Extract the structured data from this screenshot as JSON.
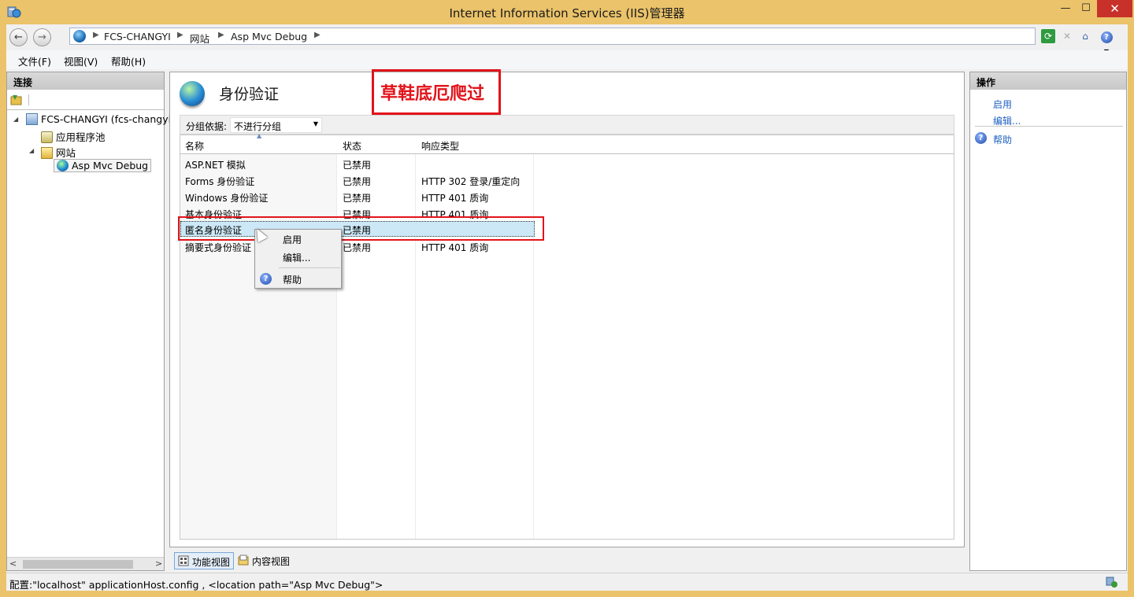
{
  "window": {
    "title": "Internet Information Services (IIS)管理器",
    "buttons": {
      "minimize": "—",
      "maximize": "☐",
      "close": "✕"
    }
  },
  "navigation": {
    "back_icon": "back-arrow-icon",
    "forward_icon": "forward-arrow-icon",
    "breadcrumbs": [
      "FCS-CHANGYI",
      "网站",
      "Asp Mvc Debug"
    ],
    "tool_icons": [
      "refresh-icon",
      "stop-icon",
      "home-icon",
      "help-icon"
    ]
  },
  "menu": [
    "文件(F)",
    "视图(V)",
    "帮助(H)"
  ],
  "connections": {
    "title": "连接",
    "tree": [
      {
        "label": "FCS-CHANGYI (fcs-changyi",
        "icon": "server-icon"
      },
      {
        "label": "应用程序池",
        "icon": "app-pool-icon"
      },
      {
        "label": "网站",
        "icon": "sites-folder-icon"
      },
      {
        "label": "Asp Mvc Debug",
        "icon": "website-globe-icon"
      }
    ]
  },
  "feature": {
    "title": "身份验证",
    "annotation": "草鞋底厄爬过",
    "group_by_label": "分组依据:",
    "group_by_value": "不进行分组",
    "columns": [
      "名称",
      "状态",
      "响应类型"
    ],
    "rows": [
      {
        "name": "ASP.NET 模拟",
        "status": "已禁用",
        "response": ""
      },
      {
        "name": "Forms 身份验证",
        "status": "已禁用",
        "response": "HTTP 302 登录/重定向"
      },
      {
        "name": "Windows 身份验证",
        "status": "已禁用",
        "response": "HTTP 401 质询"
      },
      {
        "name": "基本身份验证",
        "status": "已禁用",
        "response": "HTTP 401 质询"
      },
      {
        "name": "匿名身份验证",
        "status": "已禁用",
        "response": ""
      },
      {
        "name": "摘要式身份验证",
        "status": "已禁用",
        "response": "HTTP 401 质询"
      }
    ]
  },
  "context_menu": [
    "启用",
    "编辑...",
    "帮助"
  ],
  "view_tabs": [
    "功能视图",
    "内容视图"
  ],
  "actions": {
    "title": "操作",
    "links": [
      "启用",
      "编辑...",
      "帮助"
    ]
  },
  "status": {
    "text": "配置:\"localhost\" applicationHost.config , <location path=\"Asp Mvc Debug\">"
  },
  "colors": {
    "accent_link": "#1f61c1",
    "annotation_red": "#e2131a",
    "selected_row": "#cce8f6",
    "close_button": "#c7312a"
  }
}
